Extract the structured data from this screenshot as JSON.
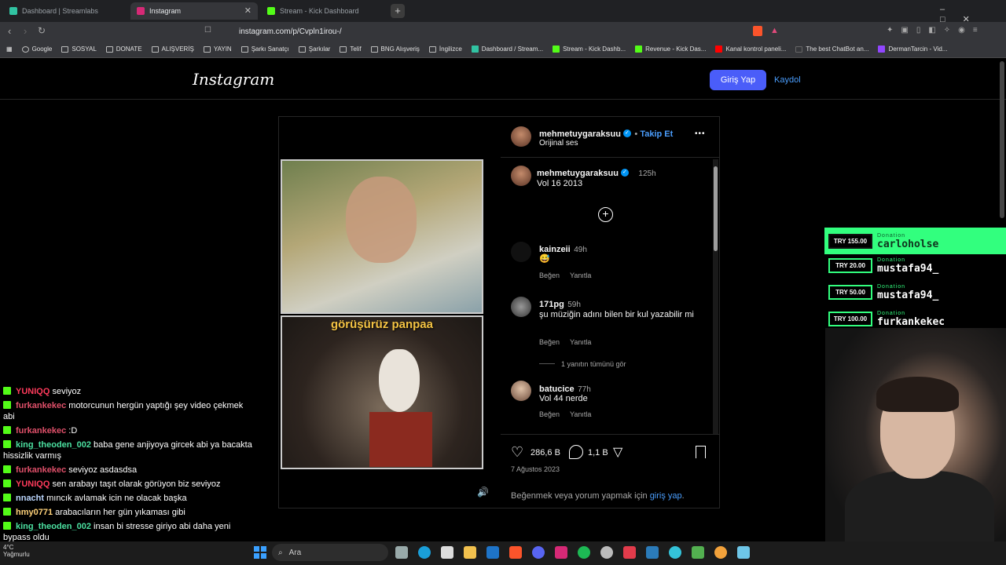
{
  "browser": {
    "tabs": [
      {
        "label": "Dashboard | Streamlabs",
        "color": "#31c3a2"
      },
      {
        "label": "Instagram",
        "color": "#d62976"
      },
      {
        "label": "Stream - Kick Dashboard",
        "color": "#53fc18"
      }
    ],
    "url": "instagram.com/p/Cvpln1irou-/",
    "bookmarks": [
      "Google",
      "SOSYAL",
      "DONATE",
      "ALIŞVERİŞ",
      "YAYIN",
      "Şarkı Sanatçı",
      "Şarkılar",
      "Telif",
      "BNG Alışveriş",
      "İngilizce",
      "Dashboard / Stream...",
      "Stream - Kick Dashb...",
      "Revenue - Kick Das...",
      "Kanal kontrol paneli...",
      "The best ChatBot an...",
      "DermanTarcin - Vid..."
    ]
  },
  "instagram": {
    "logo": "Instagram",
    "login_label": "Giriş Yap",
    "signup_label": "Kaydol",
    "video_caption": "görüşürüz panpaa",
    "author": {
      "name": "mehmetuygaraksuu",
      "follow": "Takip Et",
      "audio": "Orijinal ses",
      "more": "•••"
    },
    "caption": {
      "name": "mehmetuygaraksuu",
      "time": "125h",
      "text": "Vol 16 2013"
    },
    "comments": [
      {
        "user": "kainzeii",
        "time": "49h",
        "text": "😅",
        "like": "Beğen",
        "reply": "Yanıtla"
      },
      {
        "user": "171pg",
        "time": "59h",
        "text": "şu müziğin adını bilen bir kul yazabilir mi",
        "like": "Beğen",
        "reply": "Yanıtla"
      },
      {
        "user": "batucice",
        "time": "77h",
        "text": "Vol 44 nerde",
        "like": "Beğen",
        "reply": "Yanıtla"
      }
    ],
    "view_replies": "1 yanıtın tümünü gör",
    "likes": "286,6 B",
    "comment_count": "1,1 B",
    "date": "7 Ağustos 2023",
    "login_prompt_prefix": "Beğenmek veya yorum yapmak için ",
    "login_prompt_link": "giriş yap",
    "login_prompt_suffix": "."
  },
  "donations": [
    {
      "amount": "TRY 155.00",
      "label": "Donation",
      "name": "carloholse"
    },
    {
      "amount": "TRY 20.00",
      "label": "Donation",
      "name": "mustafa94_"
    },
    {
      "amount": "TRY 50.00",
      "label": "Donation",
      "name": "mustafa94_"
    },
    {
      "amount": "TRY 100.00",
      "label": "Donation",
      "name": "furkankekec"
    }
  ],
  "chat": [
    {
      "user": "YUNIQQ",
      "color": "#ff3b5c",
      "msg": "seviyoz"
    },
    {
      "user": "furkankekec",
      "color": "#e0506a",
      "msg": "motorcunun hergün yaptığı şey video çekmek abi"
    },
    {
      "user": "furkankekec",
      "color": "#e0506a",
      "msg": ":D"
    },
    {
      "user": "king_theoden_002",
      "color": "#4be0a0",
      "msg": "baba gene anjiyoya gircek abi ya bacakta hissizlik varmış"
    },
    {
      "user": "furkankekec",
      "color": "#e0506a",
      "msg": "seviyoz asdasdsa"
    },
    {
      "user": "YUNIQQ",
      "color": "#ff3b5c",
      "msg": "sen arabayı taşıt olarak görüyon biz seviyoz"
    },
    {
      "user": "nnacht",
      "color": "#bcd7ff",
      "msg": "mıncık avlamak icin ne olacak başka"
    },
    {
      "user": "hmy0771",
      "color": "#ffd27a",
      "msg": "arabacıların her gün yıkaması gibi"
    },
    {
      "user": "king_theoden_002",
      "color": "#4be0a0",
      "msg": "insan bi stresse giriyo abi daha yeni bypass oldu"
    }
  ],
  "taskbar": {
    "search": "Ara",
    "weather_temp": "4°C",
    "weather_text": "Yağmurlu"
  }
}
